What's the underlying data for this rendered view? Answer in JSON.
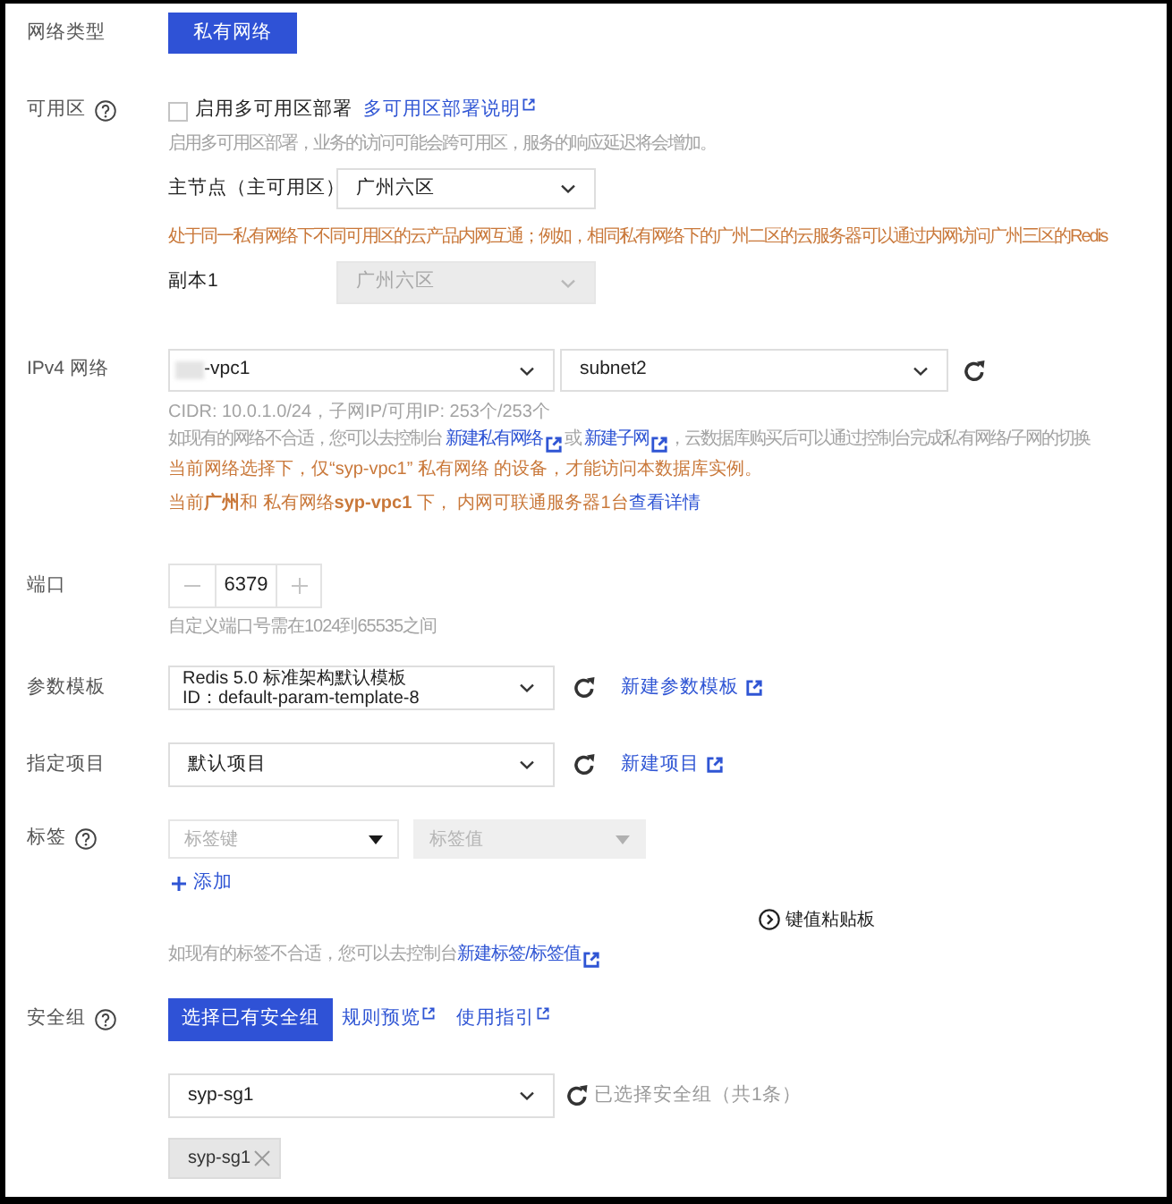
{
  "network_type": {
    "label": "网络类型",
    "button": "私有网络"
  },
  "availability_zone": {
    "label": "可用区",
    "multi_az": {
      "label": "启用多可用区部署",
      "checked": false
    },
    "doc_link": "多可用区部署说明",
    "help": "启用多可用区部署，业务的访问可能会跨可用区，服务的响应延迟将会增加。",
    "primary": {
      "label": "主节点（主可用区）",
      "value": "广州六区",
      "disabled": false
    },
    "warning": "处于同一私有网络下不同可用区的云产品内网互通；例如，相同私有网络下的广州二区的云服务器可以通过内网访问广州三区的Redis",
    "replicas": [
      {
        "label": "副本1",
        "value": "广州六区",
        "disabled": true
      }
    ]
  },
  "ipv4_network": {
    "label": "IPv4 网络",
    "vpc": {
      "value": "-vpc1"
    },
    "subnet": {
      "value": "subnet2"
    },
    "cidr": "CIDR: 10.0.1.0/24，子网IP/可用IP: 253个/253个",
    "hint": [
      {
        "kind": "text",
        "text": "如现有的网络不合适，您可以去控制台 "
      },
      {
        "kind": "external_link",
        "text": "新建私有网络"
      },
      {
        "kind": "text",
        "text": " 或 "
      },
      {
        "kind": "external_link",
        "text": "新建子网"
      },
      {
        "kind": "text",
        "text": "，云数据库购买后可以通过控制台完成私有网络/子网的切换"
      }
    ],
    "notices": [
      [
        {
          "kind": "text",
          "text": "当前网络选择下，仅“syp-vpc1” 私有网络 的设备，才能访问本数据库实例。"
        }
      ],
      [
        {
          "kind": "text",
          "text": "当前**广州**和 私有网络**syp-vpc1** 下， 内网可联通服务器1台"
        },
        {
          "kind": "link",
          "text": "查看详情"
        }
      ]
    ]
  },
  "port": {
    "label": "端口",
    "value": "6379",
    "help": "自定义端口号需在1024到65535之间"
  },
  "param_template": {
    "label": "参数模板",
    "value_lines": [
      "Redis 5.0 标准架构默认模板",
      "ID：default-param-template-8"
    ],
    "link": "新建参数模板"
  },
  "project": {
    "label": "指定项目",
    "value": "默认项目",
    "link": "新建项目"
  },
  "tags": {
    "label": "标签",
    "rows": [
      {
        "key": {
          "placeholder": "标签键",
          "disabled": false
        },
        "value": {
          "placeholder": "标签值",
          "disabled": true
        }
      }
    ],
    "add_button": "添加",
    "paste_board": "键值粘贴板",
    "hint": [
      {
        "kind": "text",
        "text": "如现有的标签不合适，您可以去控制台"
      },
      {
        "kind": "external_link",
        "text": "新建标签/标签值"
      }
    ]
  },
  "security_group": {
    "label": "安全组",
    "select_button": "选择已有安全组",
    "links": [
      "规则预览",
      "使用指引"
    ],
    "select": {
      "value": "syp-sg1"
    },
    "summary": "已选择安全组（共1条）",
    "chips": [
      "syp-sg1"
    ]
  }
}
